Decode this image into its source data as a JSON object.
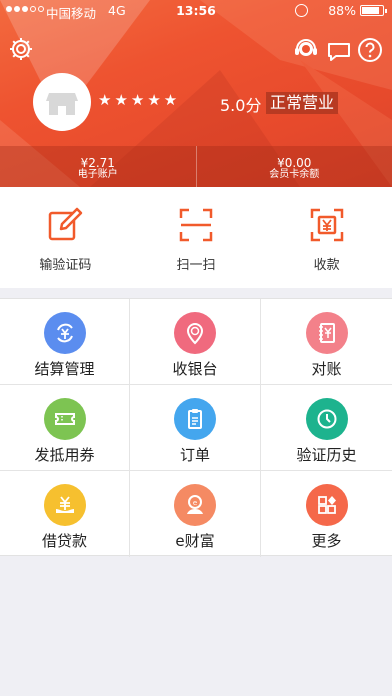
{
  "status_bar": {
    "carrier": "中国移动",
    "network": "4G",
    "time": "13:56",
    "battery": "88%"
  },
  "header": {
    "stars": "★★★★★",
    "score": "5.0分",
    "status": "正常营业",
    "accounts": [
      {
        "amount": "¥2.71",
        "label": "电子账户"
      },
      {
        "amount": "¥0.00",
        "label": "会员卡余额"
      }
    ]
  },
  "quick_actions": [
    {
      "label": "输验证码",
      "icon": "edit-icon"
    },
    {
      "label": "扫一扫",
      "icon": "scan-icon"
    },
    {
      "label": "收款",
      "icon": "receive-payment-icon"
    }
  ],
  "grid": [
    {
      "label": "结算管理",
      "icon": "settlement-icon",
      "color": "#5b8def"
    },
    {
      "label": "收银台",
      "icon": "cashier-icon",
      "color": "#f06a7e"
    },
    {
      "label": "对账",
      "icon": "reconcile-icon",
      "color": "#f3818a"
    },
    {
      "label": "发抵用券",
      "icon": "coupon-icon",
      "color": "#7dc452"
    },
    {
      "label": "订单",
      "icon": "order-icon",
      "color": "#44a6ee"
    },
    {
      "label": "验证历史",
      "icon": "clock-icon",
      "color": "#1db38e"
    },
    {
      "label": "借贷款",
      "icon": "loan-icon",
      "color": "#f6c02f"
    },
    {
      "label": "e财富",
      "icon": "wealth-icon",
      "color": "#f58a63"
    },
    {
      "label": "更多",
      "icon": "more-icon",
      "color": "#f5684a"
    }
  ],
  "colors": {
    "accent": "#ee5330",
    "action_orange": "#f15a2b"
  }
}
